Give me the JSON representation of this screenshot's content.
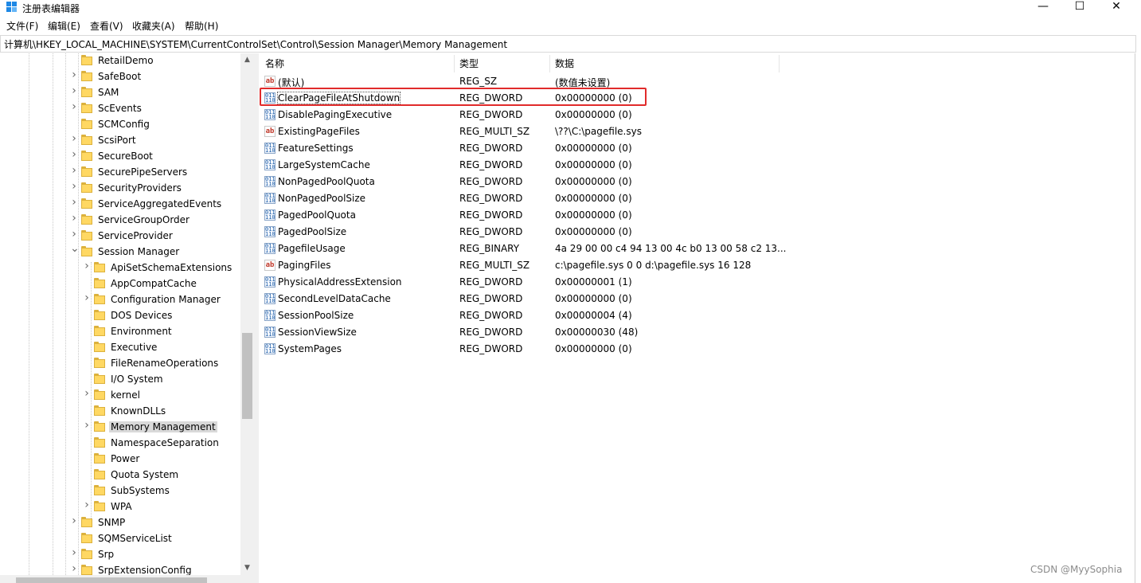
{
  "window": {
    "title": "注册表编辑器",
    "min_glyph": "—",
    "max_glyph": "☐",
    "close_glyph": "✕"
  },
  "menu": [
    "文件(F)",
    "编辑(E)",
    "查看(V)",
    "收藏夹(A)",
    "帮助(H)"
  ],
  "address": "计算机\\HKEY_LOCAL_MACHINE\\SYSTEM\\CurrentControlSet\\Control\\Session Manager\\Memory Management",
  "tree": {
    "items": [
      {
        "label": "RetailDemo",
        "expander": ""
      },
      {
        "label": "SafeBoot",
        "expander": ">"
      },
      {
        "label": "SAM",
        "expander": ">"
      },
      {
        "label": "ScEvents",
        "expander": ">"
      },
      {
        "label": "SCMConfig",
        "expander": ""
      },
      {
        "label": "ScsiPort",
        "expander": ">"
      },
      {
        "label": "SecureBoot",
        "expander": ">"
      },
      {
        "label": "SecurePipeServers",
        "expander": ">"
      },
      {
        "label": "SecurityProviders",
        "expander": ">"
      },
      {
        "label": "ServiceAggregatedEvents",
        "expander": ">"
      },
      {
        "label": "ServiceGroupOrder",
        "expander": ">"
      },
      {
        "label": "ServiceProvider",
        "expander": ">"
      },
      {
        "label": "Session Manager",
        "expander": "v"
      },
      {
        "label": "ApiSetSchemaExtensions",
        "expander": ">"
      },
      {
        "label": "AppCompatCache",
        "expander": ""
      },
      {
        "label": "Configuration Manager",
        "expander": ">"
      },
      {
        "label": "DOS Devices",
        "expander": ""
      },
      {
        "label": "Environment",
        "expander": ""
      },
      {
        "label": "Executive",
        "expander": ""
      },
      {
        "label": "FileRenameOperations",
        "expander": ""
      },
      {
        "label": "I/O System",
        "expander": ""
      },
      {
        "label": "kernel",
        "expander": ">"
      },
      {
        "label": "KnownDLLs",
        "expander": ""
      },
      {
        "label": "Memory Management",
        "expander": ">"
      },
      {
        "label": "NamespaceSeparation",
        "expander": ""
      },
      {
        "label": "Power",
        "expander": ""
      },
      {
        "label": "Quota System",
        "expander": ""
      },
      {
        "label": "SubSystems",
        "expander": ""
      },
      {
        "label": "WPA",
        "expander": ">"
      },
      {
        "label": "SNMP",
        "expander": ">"
      },
      {
        "label": "SQMServiceList",
        "expander": ""
      },
      {
        "label": "Srp",
        "expander": ">"
      },
      {
        "label": "SrpExtensionConfig",
        "expander": ">"
      }
    ],
    "selected": "Memory Management"
  },
  "values": {
    "headers": {
      "name": "名称",
      "type": "类型",
      "data": "数据"
    },
    "rows": [
      {
        "icon": "string-value-icon",
        "name": "(默认)",
        "type": "REG_SZ",
        "data": "(数值未设置)"
      },
      {
        "icon": "binary-value-icon",
        "name": "ClearPageFileAtShutdown",
        "type": "REG_DWORD",
        "data": "0x00000000 (0)"
      },
      {
        "icon": "binary-value-icon",
        "name": "DisablePagingExecutive",
        "type": "REG_DWORD",
        "data": "0x00000000 (0)"
      },
      {
        "icon": "string-value-icon",
        "name": "ExistingPageFiles",
        "type": "REG_MULTI_SZ",
        "data": "\\??\\C:\\pagefile.sys"
      },
      {
        "icon": "binary-value-icon",
        "name": "FeatureSettings",
        "type": "REG_DWORD",
        "data": "0x00000000 (0)"
      },
      {
        "icon": "binary-value-icon",
        "name": "LargeSystemCache",
        "type": "REG_DWORD",
        "data": "0x00000000 (0)"
      },
      {
        "icon": "binary-value-icon",
        "name": "NonPagedPoolQuota",
        "type": "REG_DWORD",
        "data": "0x00000000 (0)"
      },
      {
        "icon": "binary-value-icon",
        "name": "NonPagedPoolSize",
        "type": "REG_DWORD",
        "data": "0x00000000 (0)"
      },
      {
        "icon": "binary-value-icon",
        "name": "PagedPoolQuota",
        "type": "REG_DWORD",
        "data": "0x00000000 (0)"
      },
      {
        "icon": "binary-value-icon",
        "name": "PagedPoolSize",
        "type": "REG_DWORD",
        "data": "0x00000000 (0)"
      },
      {
        "icon": "binary-value-icon",
        "name": "PagefileUsage",
        "type": "REG_BINARY",
        "data": "4a 29 00 00 c4 94 13 00 4c b0 13 00 58 c2 13..."
      },
      {
        "icon": "string-value-icon",
        "name": "PagingFiles",
        "type": "REG_MULTI_SZ",
        "data": "c:\\pagefile.sys 0 0 d:\\pagefile.sys 16 128"
      },
      {
        "icon": "binary-value-icon",
        "name": "PhysicalAddressExtension",
        "type": "REG_DWORD",
        "data": "0x00000001 (1)"
      },
      {
        "icon": "binary-value-icon",
        "name": "SecondLevelDataCache",
        "type": "REG_DWORD",
        "data": "0x00000000 (0)"
      },
      {
        "icon": "binary-value-icon",
        "name": "SessionPoolSize",
        "type": "REG_DWORD",
        "data": "0x00000004 (4)"
      },
      {
        "icon": "binary-value-icon",
        "name": "SessionViewSize",
        "type": "REG_DWORD",
        "data": "0x00000030 (48)"
      },
      {
        "icon": "binary-value-icon",
        "name": "SystemPages",
        "type": "REG_DWORD",
        "data": "0x00000000 (0)"
      }
    ],
    "highlighted": "ClearPageFileAtShutdown",
    "highlight_color": "#e12b2b"
  },
  "watermark": "CSDN @MyySophia"
}
